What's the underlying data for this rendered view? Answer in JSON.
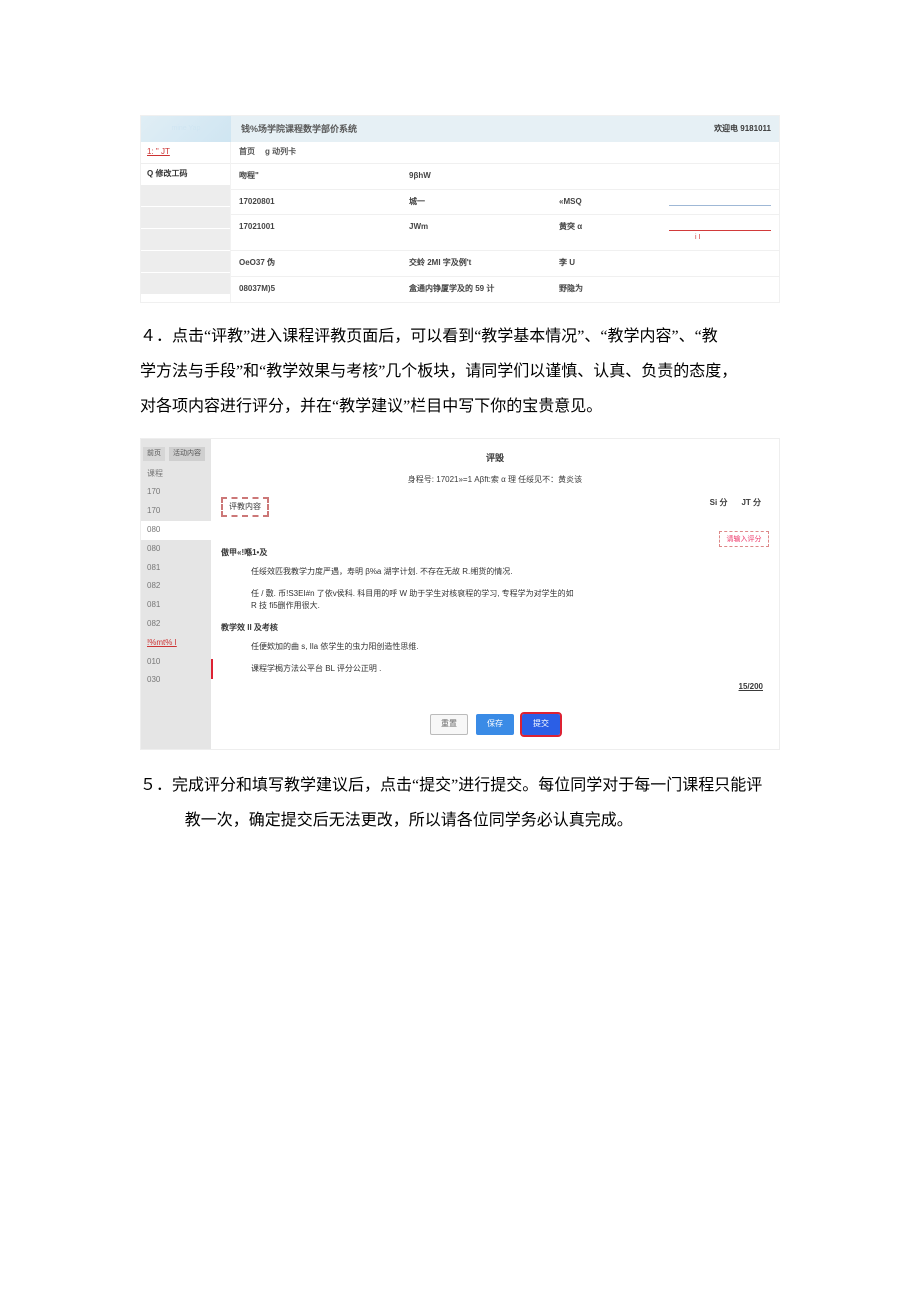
{
  "sys": {
    "title": "钱%场学院课程数学部价系统",
    "welcome": "欢迎电 9181011",
    "side": {
      "line1": "1:  \" JT",
      "line2": "Q 修改工码"
    },
    "nav": {
      "a": "首页",
      "b": "g 动列卡"
    },
    "rows": [
      {
        "c1": "吻程\"",
        "c2": "9βhW",
        "c3": "",
        "extra": "«MSQ"
      },
      {
        "c1": "17020801",
        "c2": "城一",
        "c3": ""
      },
      {
        "c1": "17021001",
        "c2": "JWm",
        "c3": "黄突 α",
        "red": "i I"
      },
      {
        "c1": "OeO37 伪",
        "c2": "交蛉 2MI 字及例't",
        "c3": "李 U"
      },
      {
        "c1": "08037M)5",
        "c2": "盒通内铮厦学及的 59 计",
        "c3": "野隐为"
      }
    ]
  },
  "para4": {
    "l1": "４．点击“评教”进入课程评教页面后，可以看到“教学基本情况”、“教学内容”、“教",
    "l2": "学方法与手段”和“教学效果与考核”几个板块，请同学们以谨慎、认真、负责的态度，",
    "l3": "对各项内容进行评分，并在“教学建议”栏目中写下你的宝贵意见。"
  },
  "eval": {
    "tabs": {
      "a": "前页",
      "b": "活动内容"
    },
    "sidenums": [
      "课程",
      "170",
      "170",
      "080",
      "080",
      "081",
      "082",
      "081",
      "082",
      "010",
      "030"
    ],
    "sidered": "!%mt% I",
    "title": "评毁",
    "sub": "身程号: 17021»=1 Aβft:索 α 理  任绥见不：黄炎该",
    "thead": {
      "a": "Si 分",
      "b": "JT 分"
    },
    "scorebox": "请输入评分",
    "tablabel": "评教内容",
    "b1_label": "傲甲«!喺1•及",
    "b1_item": "任绥效匹我教学力度严遇，寿明 β%a 湖字计划. 不存在无故 R.缃货的情况.",
    "b2_item": "任 / 敷. 币!S3EI#n 了依v侯科. 科目用的呼 W 助于学生对核裒程的学习, 专程学为对学生的如 R 技 fi5删作用很大.",
    "b3_label": "教学效 II 及考核",
    "b3_item": "任便欸加的曲 s, Ila 依学生的虫力阳创造性思维.",
    "b4_item": "课程学梮方法公平台 BL 评分公正明 .",
    "count": "15/200",
    "btn_reset": "重置",
    "btn_save": "保存",
    "btn_submit": "提交"
  },
  "para5": {
    "l1": "５．完成评分和填写教学建议后，点击“提交”进行提交。每位同学对于每一门课程只能评",
    "l2": "教一次，确定提交后无法更改，所以请各位同学务必认真完成。"
  }
}
